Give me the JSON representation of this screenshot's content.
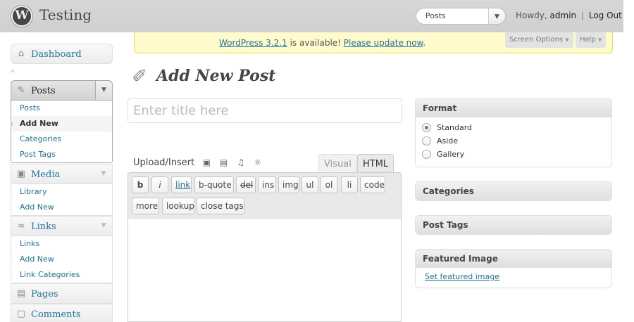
{
  "header": {
    "site_title": "Testing",
    "favorite_action": "Posts",
    "howdy": "Howdy,",
    "username": "admin",
    "separator": "|",
    "logout": "Log Out"
  },
  "update_nag": {
    "version_link": "WordPress 3.2.1",
    "middle_text": " is available! ",
    "update_link": "Please update now",
    "end_text": "."
  },
  "meta_tabs": {
    "screen_options": "Screen Options",
    "help": "Help"
  },
  "menu": {
    "dashboard": "Dashboard",
    "posts": {
      "label": "Posts",
      "items": [
        {
          "label": "Posts"
        },
        {
          "label": "Add New"
        },
        {
          "label": "Categories"
        },
        {
          "label": "Post Tags"
        }
      ]
    },
    "media": {
      "label": "Media",
      "items": [
        {
          "label": "Library"
        },
        {
          "label": "Add New"
        }
      ]
    },
    "links": {
      "label": "Links",
      "items": [
        {
          "label": "Links"
        },
        {
          "label": "Add New"
        },
        {
          "label": "Link Categories"
        }
      ]
    },
    "pages": "Pages",
    "comments": "Comments"
  },
  "page": {
    "title": "Add New Post",
    "title_placeholder": "Enter title here"
  },
  "editor": {
    "upload_insert": "Upload/Insert",
    "tab_visual": "Visual",
    "tab_html": "HTML",
    "quicktags": [
      "b",
      "i",
      "link",
      "b-quote",
      "del",
      "ins",
      "img",
      "ul",
      "ol",
      "li",
      "code",
      "more",
      "lookup",
      "close tags"
    ]
  },
  "sidebar": {
    "format": {
      "title": "Format",
      "options": [
        "Standard",
        "Aside",
        "Gallery"
      ],
      "selected": "Standard"
    },
    "categories_title": "Categories",
    "tags_title": "Post Tags",
    "featured": {
      "title": "Featured Image",
      "link": "Set featured image"
    }
  },
  "colors": {
    "link": "#21759b",
    "nag_bg": "#fffbcc",
    "header_bg": "#d7d7d7"
  }
}
